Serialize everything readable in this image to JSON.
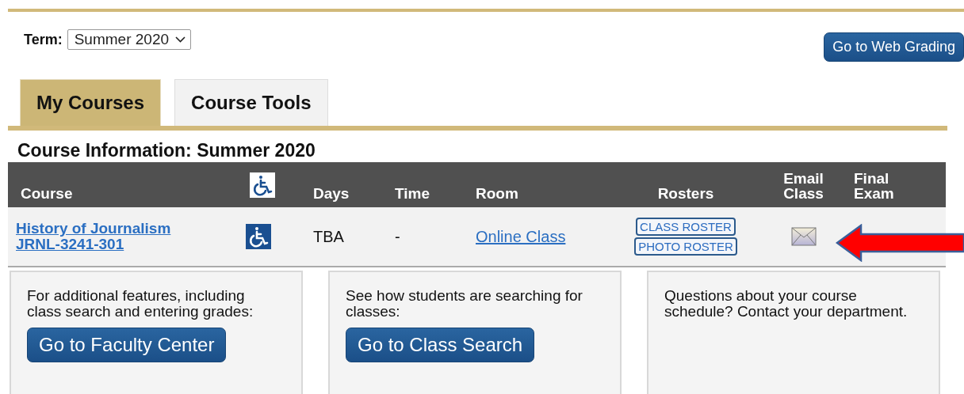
{
  "term": {
    "label": "Term:",
    "value": "Summer 2020"
  },
  "web_grading_button": "Go to Web Grading",
  "tabs": [
    {
      "label": "My Courses",
      "selected": true
    },
    {
      "label": "Course Tools",
      "selected": false
    }
  ],
  "heading": "Course Information: Summer 2020",
  "table": {
    "columns": [
      "Course",
      {
        "kind": "icon"
      },
      "Days",
      "Time",
      "Room",
      "Rosters",
      "Email Class",
      "Final Exam"
    ],
    "rows": [
      {
        "course": "History of Journalism",
        "section": "JRNL-3241-301",
        "accessible": true,
        "days": "TBA",
        "time": "-",
        "room": "Online Class",
        "rosters": [
          "CLASS ROSTER",
          "PHOTO ROSTER"
        ]
      }
    ]
  },
  "annotation": {
    "kind": "arrow"
  },
  "panels": [
    {
      "text": "For additional features, including class search and entering grades:",
      "button": "Go to Faculty Center"
    },
    {
      "text": "See how students are searching for classes:",
      "button": "Go to Class Search"
    },
    {
      "text": "Questions about your course schedule? Contact your department."
    }
  ]
}
